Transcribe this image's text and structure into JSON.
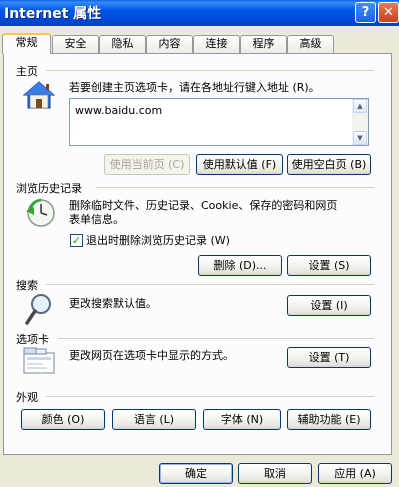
{
  "window": {
    "title": "Internet 属性",
    "help": "?",
    "close": "✕"
  },
  "tabs": [
    {
      "label": "常规"
    },
    {
      "label": "安全"
    },
    {
      "label": "隐私"
    },
    {
      "label": "内容"
    },
    {
      "label": "连接"
    },
    {
      "label": "程序"
    },
    {
      "label": "高级"
    }
  ],
  "home": {
    "title": "主页",
    "description": "若要创建主页选项卡，请在各地址行键入地址 (R)。",
    "url": "www.baidu.com",
    "use_current": "使用当前页 (C)",
    "use_default": "使用默认值 (F)",
    "use_blank": "使用空白页 (B)"
  },
  "history": {
    "title": "浏览历史记录",
    "description_line1": "删除临时文件、历史记录、Cookie、保存的密码和网页",
    "description_line2": "表单信息。",
    "checkbox_label": "退出时删除浏览历史记录 (W)",
    "checked": true,
    "delete": "删除 (D)...",
    "settings": "设置 (S)"
  },
  "search": {
    "title": "搜索",
    "description": "更改搜索默认值。",
    "settings": "设置 (I)"
  },
  "tabs_section": {
    "title": "选项卡",
    "description": "更改网页在选项卡中显示的方式。",
    "settings": "设置 (T)"
  },
  "appearance": {
    "title": "外观",
    "colors": "颜色 (O)",
    "languages": "语言 (L)",
    "fonts": "字体 (N)",
    "accessibility": "辅助功能 (E)"
  },
  "footer": {
    "ok": "确定",
    "cancel": "取消",
    "apply": "应用 (A)"
  }
}
